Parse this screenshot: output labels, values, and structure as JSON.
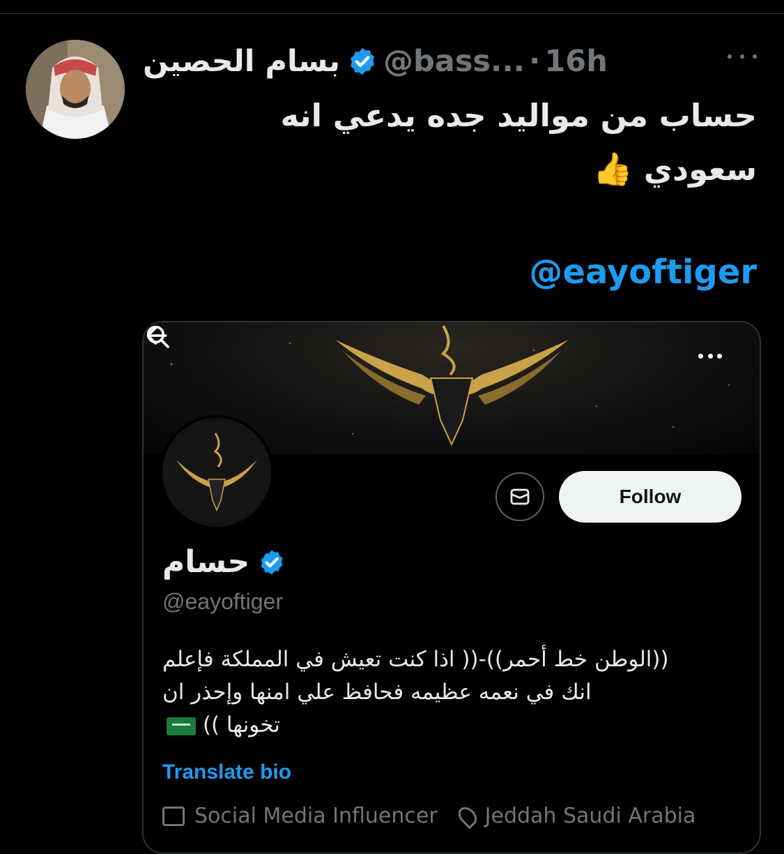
{
  "tweet": {
    "display_name": "بسام الحصين",
    "handle": "@bass...",
    "separator": "·",
    "time": "16h",
    "text_line1": "حساب من مواليد جده يدعي انه",
    "text_line2": "سعودي",
    "emoji": "👍",
    "mention": "@eayoftiger"
  },
  "embedded_profile": {
    "name": "حسام",
    "handle": "@eayoftiger",
    "follow_label": "Follow",
    "bio_line1": "((الوطن خط أحمر))-(( اذا كنت تعيش في المملكة فإعلم",
    "bio_line2": "انك في نعمه عظيمه فحافظ علي امنها وإحذر ان",
    "bio_line3": "تخونها ))",
    "translate_label": "Translate bio",
    "category": "Social Media Influencer",
    "location": "Jeddah Saudi Arabia"
  },
  "colors": {
    "background": "#000000",
    "link": "#1d9bf0",
    "verified": "#1d9bf0",
    "muted": "#71767b",
    "gold": "#c9a24a"
  },
  "icons": [
    "avatar-photo",
    "verified-badge-icon",
    "more-icon",
    "back-arrow-icon",
    "search-icon",
    "envelope-icon",
    "briefcase-icon",
    "location-pin-icon",
    "saudi-flag-icon"
  ]
}
